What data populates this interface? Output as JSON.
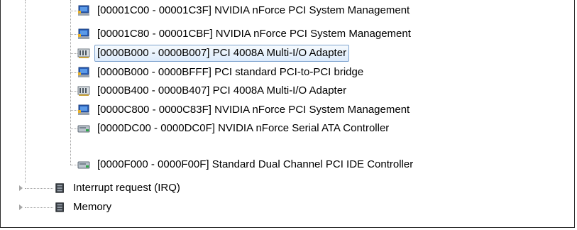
{
  "tree": {
    "io_items": [
      {
        "label": "[00001C00 - 00001C3F]  NVIDIA nForce PCI System Management",
        "icon": "system-device-icon"
      },
      {
        "label": "[00001C80 - 00001CBF]  NVIDIA nForce PCI System Management",
        "icon": "system-device-icon"
      },
      {
        "label": "[0000B000 - 0000B007]  PCI 4008A Multi-I/O Adapter",
        "icon": "multi-io-adapter-icon",
        "selected": true
      },
      {
        "label": "[0000B000 - 0000BFFF]  PCI standard PCI-to-PCI bridge",
        "icon": "system-device-icon"
      },
      {
        "label": "[0000B400 - 0000B407]  PCI 4008A Multi-I/O Adapter",
        "icon": "multi-io-adapter-icon"
      },
      {
        "label": "[0000C800 - 0000C83F]  NVIDIA nForce PCI System Management",
        "icon": "system-device-icon"
      },
      {
        "label": "[0000DC00 - 0000DC0F]  NVIDIA nForce Serial ATA Controller",
        "icon": "storage-controller-icon"
      },
      {
        "label": "[0000F000 - 0000F00F]  Standard Dual Channel PCI IDE Controller",
        "icon": "storage-controller-icon"
      }
    ],
    "categories": [
      {
        "label": "Interrupt request (IRQ)",
        "icon": "resource-category-icon",
        "expanded": false
      },
      {
        "label": "Memory",
        "icon": "resource-category-icon",
        "expanded": false
      }
    ]
  },
  "colors": {
    "selection_border": "#7da2ce",
    "selection_fill": "#dcebfc",
    "tree_lines": "#a0a0a0"
  }
}
